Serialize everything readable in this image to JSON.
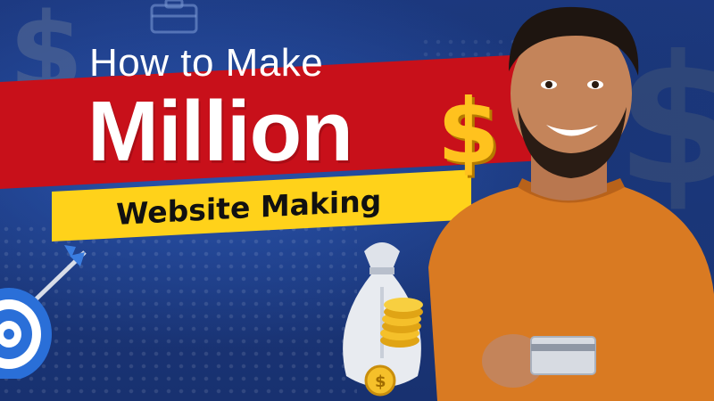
{
  "thumbnail": {
    "title_line1": "How to Make",
    "title_line2": "Million",
    "title_symbol": "$",
    "subtitle": "Website Making"
  },
  "colors": {
    "background": "#1f3f8a",
    "red_band": "#c8101a",
    "yellow_band": "#ffd21a",
    "gold": "#ffc21e",
    "sweater": "#d97a22"
  },
  "icons": [
    "dollar-icon",
    "target-icon",
    "money-bag-icon",
    "coin-icon",
    "credit-card-icon",
    "briefcase-icon"
  ]
}
